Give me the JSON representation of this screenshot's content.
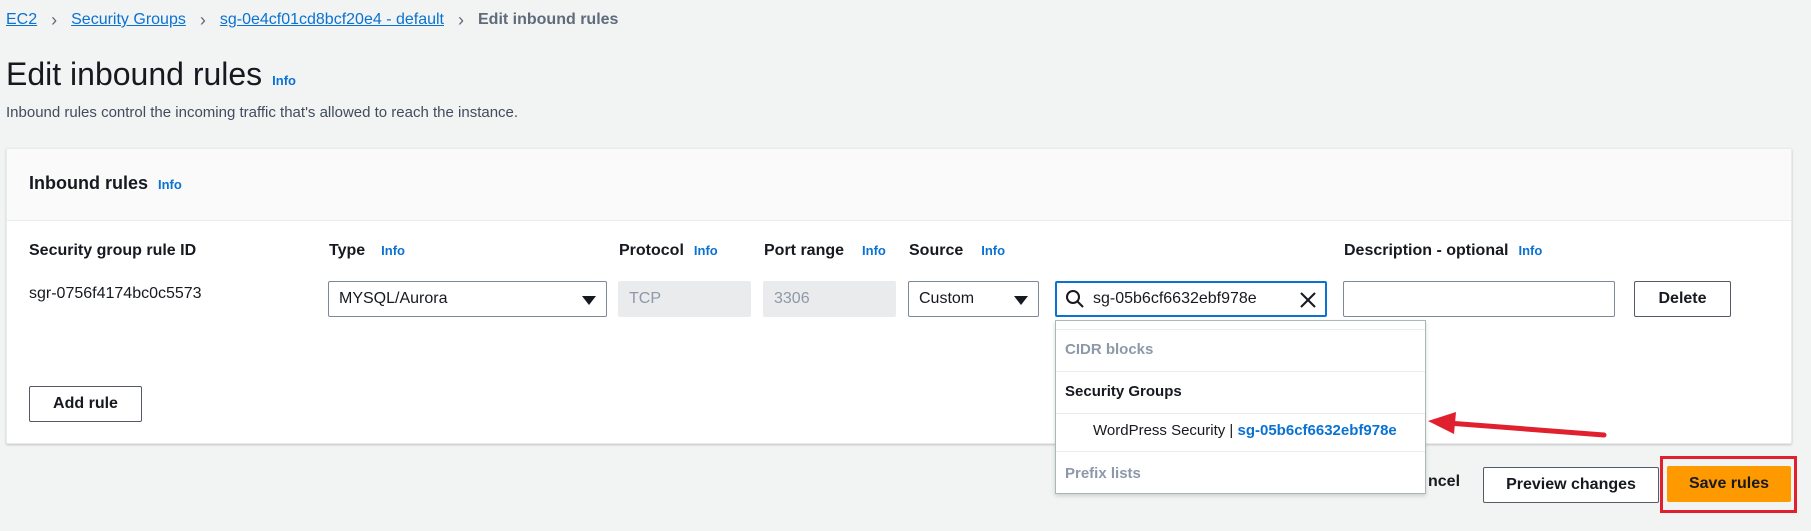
{
  "breadcrumb": {
    "items": [
      "EC2",
      "Security Groups",
      "sg-0e4cf01cd8bcf20e4 - default"
    ],
    "current": "Edit inbound rules"
  },
  "page": {
    "title": "Edit inbound rules",
    "info": "Info",
    "description": "Inbound rules control the incoming traffic that's allowed to reach the instance."
  },
  "panel": {
    "title": "Inbound rules",
    "info": "Info",
    "columns": {
      "rule_id": "Security group rule ID",
      "type": "Type",
      "protocol": "Protocol",
      "port_range": "Port range",
      "source": "Source",
      "description": "Description - optional"
    },
    "info_label": "Info",
    "row": {
      "rule_id": "sgr-0756f4174bc0c5573",
      "type": "MYSQL/Aurora",
      "protocol": "TCP",
      "port_range": "3306",
      "source": "Custom",
      "source_search": "sg-05b6cf6632ebf978e",
      "description": "",
      "delete_label": "Delete"
    },
    "add_rule_label": "Add rule"
  },
  "dropdown": {
    "groups": {
      "cidr": "CIDR blocks",
      "security_groups": "Security Groups",
      "prefix": "Prefix lists"
    },
    "option": {
      "name": "WordPress Security | ",
      "id": "sg-05b6cf6632ebf978e"
    }
  },
  "footer": {
    "cancel_partial": "ncel",
    "preview_label": "Preview changes",
    "save_label": "Save rules"
  },
  "colors": {
    "link": "#0972d3",
    "save_button": "#ff9900",
    "annotation": "#e0202e"
  }
}
